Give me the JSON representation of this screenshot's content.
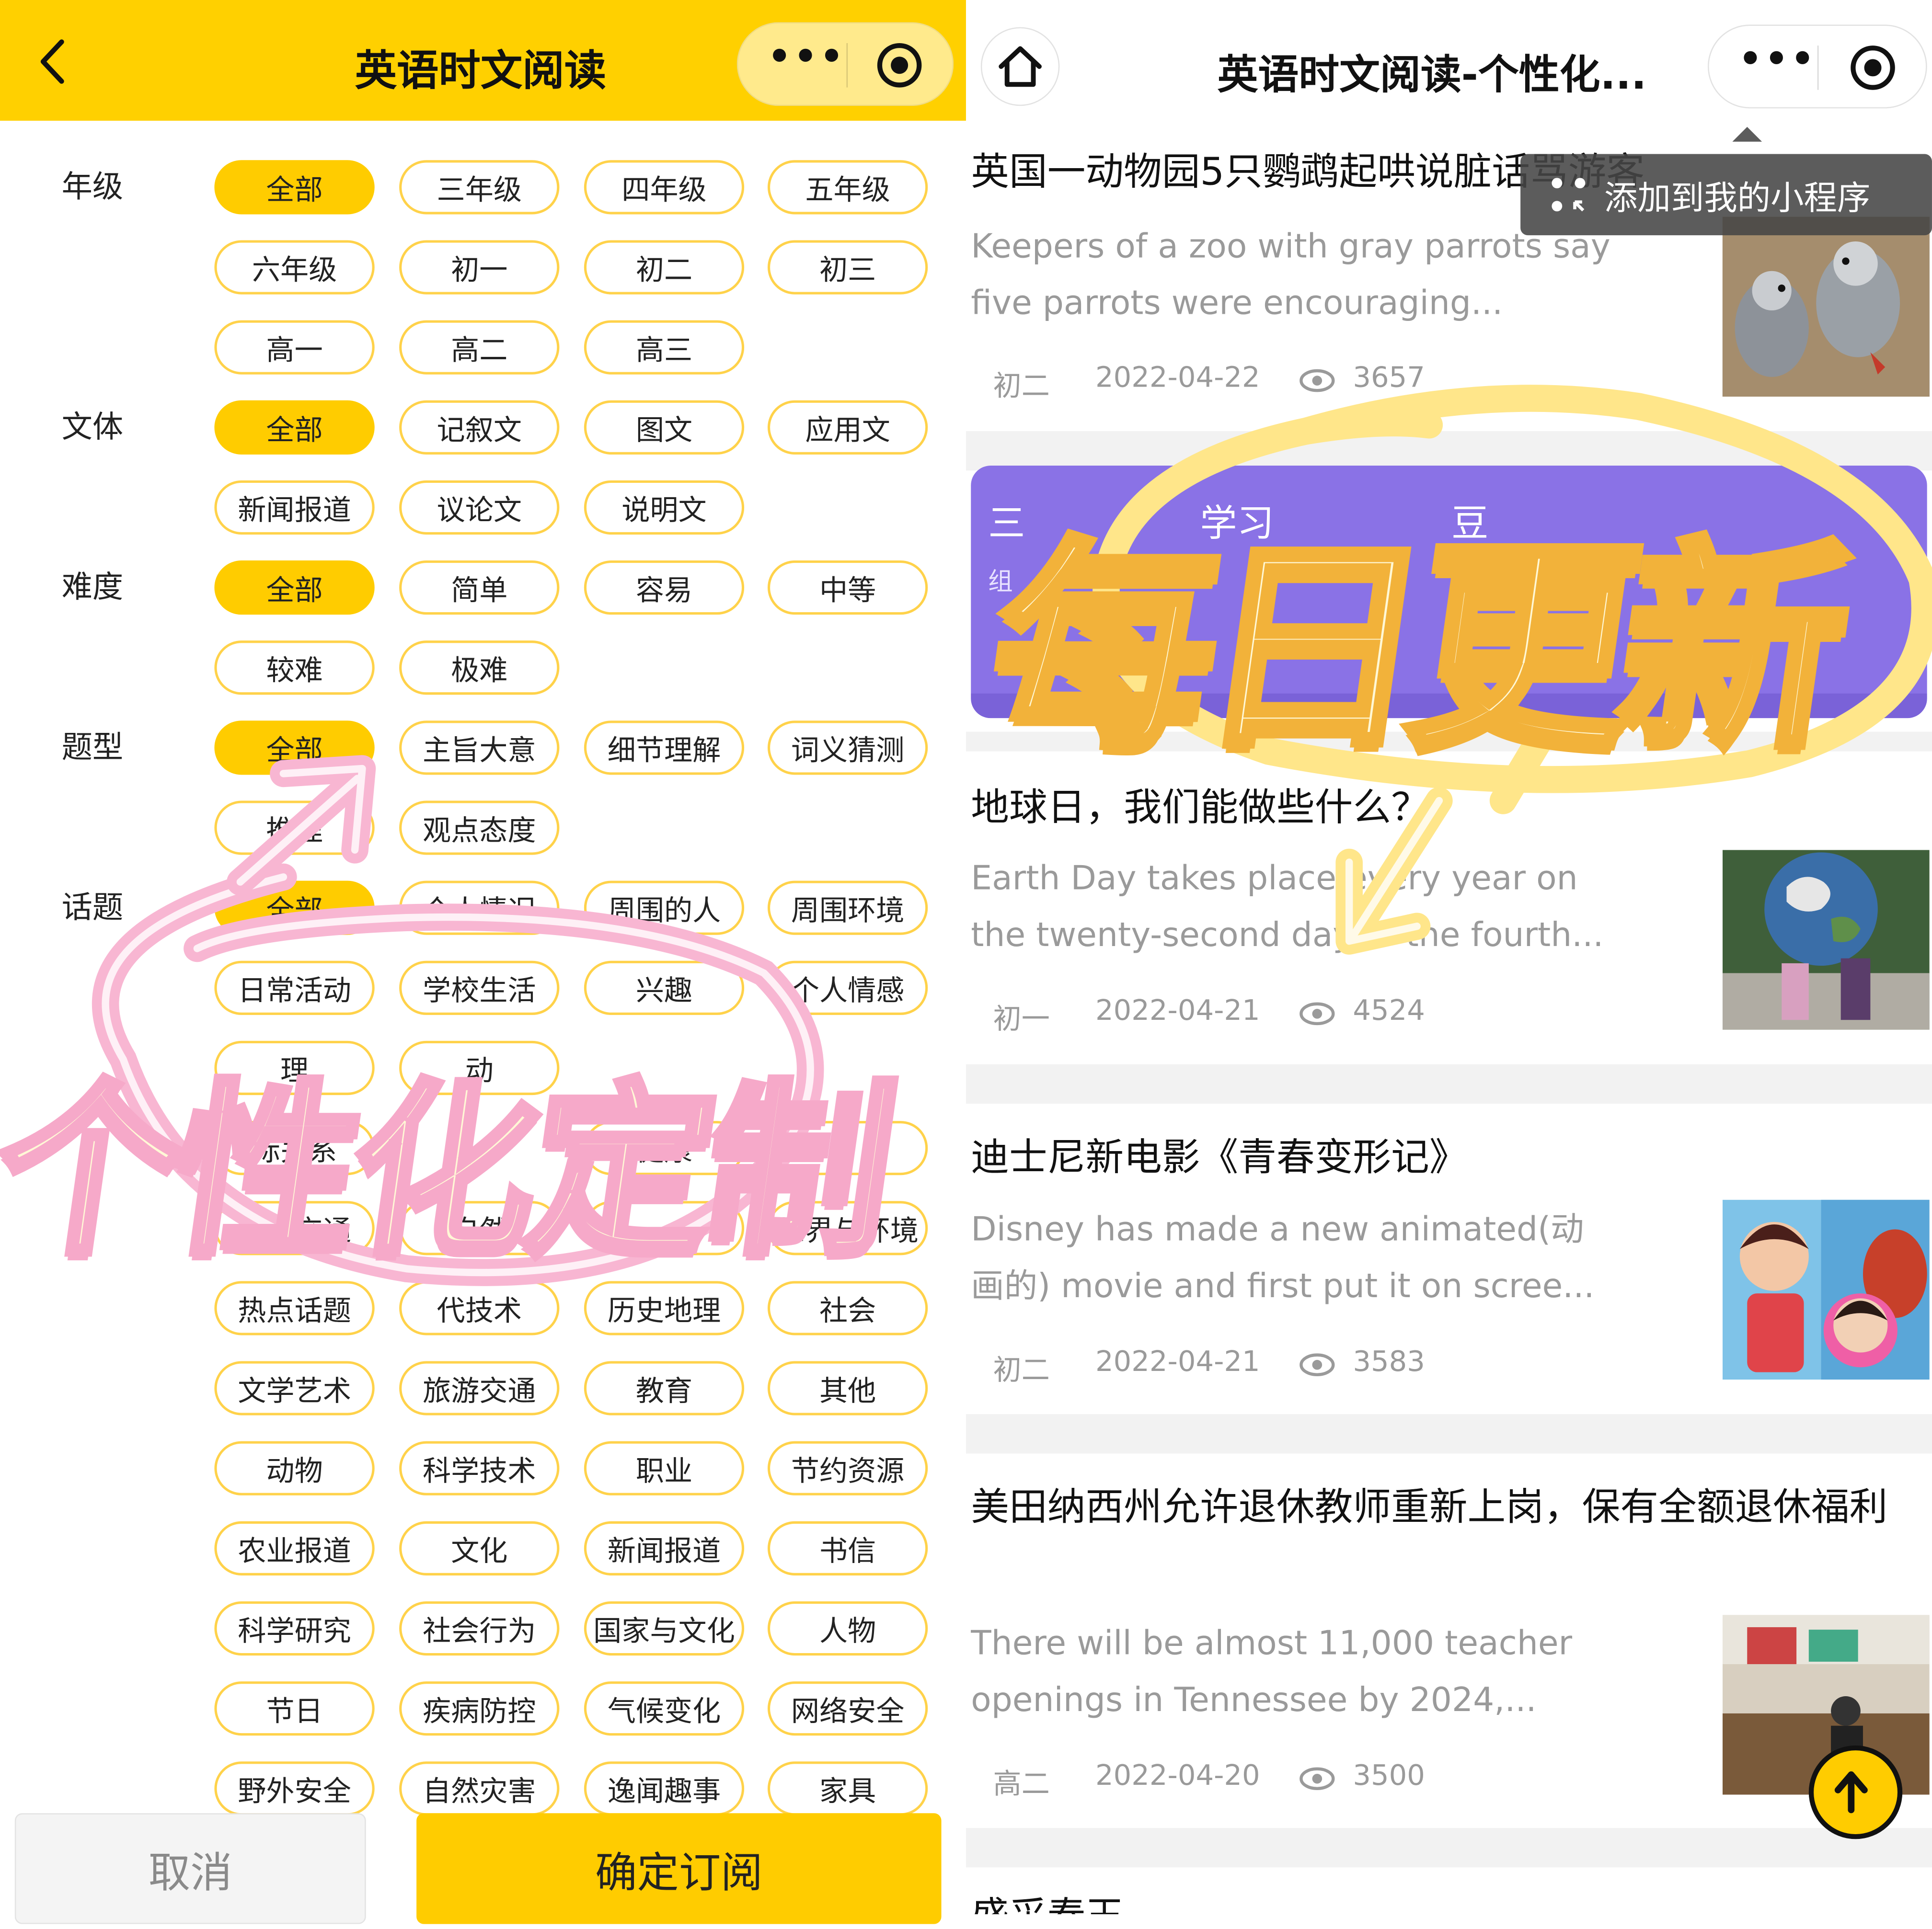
{
  "left": {
    "title": "英语时文阅读",
    "rows": [
      {
        "label": "年级"
      },
      {
        "label": "文体"
      },
      {
        "label": "难度"
      },
      {
        "label": "题型"
      },
      {
        "label": "话题"
      }
    ],
    "chips": [
      "全部",
      "三年级",
      "四年级",
      "五年级",
      "六年级",
      "初一",
      "初二",
      "初三",
      "高一",
      "高二",
      "高三",
      "全部",
      "记叙文",
      "图文",
      "应用文",
      "新闻报道",
      "议论文",
      "说明文",
      "全部",
      "简单",
      "容易",
      "中等",
      "较难",
      "极难",
      "全部",
      "主旨大意",
      "细节理解",
      "词义猜测",
      "推理",
      "观点态度",
      "全部",
      "个人情况",
      "周围的人",
      "周围环境",
      "日常活动",
      "学校生活",
      "兴趣",
      "个人情感",
      "理",
      "动",
      "际关系",
      "健康",
      "",
      "旅游交通",
      "自然",
      "",
      "世界与环境",
      "热点话题",
      "代技术",
      "历史地理",
      "社会",
      "文学艺术",
      "旅游交通",
      "教育",
      "其他",
      "动物",
      "科学技术",
      "职业",
      "节约资源",
      "农业报道",
      "文化",
      "新闻报道",
      "书信",
      "科学研究",
      "社会行为",
      "国家与文化",
      "人物",
      "节日",
      "疾病防控",
      "气候变化",
      "网络安全",
      "野外安全",
      "自然灾害",
      "逸闻趣事",
      "家具"
    ],
    "cancel_label": "取消",
    "confirm_label": "确定订阅",
    "overlay_text": "个性化定制"
  },
  "right": {
    "title": "英语时文阅读-个性化...",
    "tooltip": "添加到我的小程序",
    "banner_text": "三",
    "banner_sub": "组",
    "banner_mid": "学习",
    "banner_mid2": "豆",
    "articles": [
      {
        "title": "英国一动物园5只鹦鹉起哄说脏话骂游客",
        "snippet": "Keepers of a zoo with gray parrots say five parrots were encouraging...",
        "grade": "初二",
        "date": "2022-04-22",
        "views": "3657"
      },
      {
        "title": "地球日，我们能做些什么？",
        "snippet": "Earth Day takes place every year on the twenty-second day of the fourth...",
        "grade": "初一",
        "date": "2022-04-21",
        "views": "4524"
      },
      {
        "title": "迪士尼新电影《青春变形记》",
        "snippet": "Disney has made a new animated(动画的) movie and first put it on scree...",
        "grade": "初二",
        "date": "2022-04-21",
        "views": "3583"
      },
      {
        "title": "美田纳西州允许退休教师重新上岗，保有全额退休福利",
        "snippet": "There will be almost 11,000 teacher openings in Tennessee by 2024,...",
        "grade": "高二",
        "date": "2022-04-20",
        "views": "3500"
      }
    ],
    "next_title_partial": "盛采春玉",
    "overlay_text": "每日更新"
  },
  "colors": {
    "brand_yellow": "#ffd000",
    "chip_border": "#ffd24a",
    "banner_purple": "#8a72e6",
    "overlay_pink": "#f6a9c9",
    "overlay_cream": "#fff8d6"
  }
}
